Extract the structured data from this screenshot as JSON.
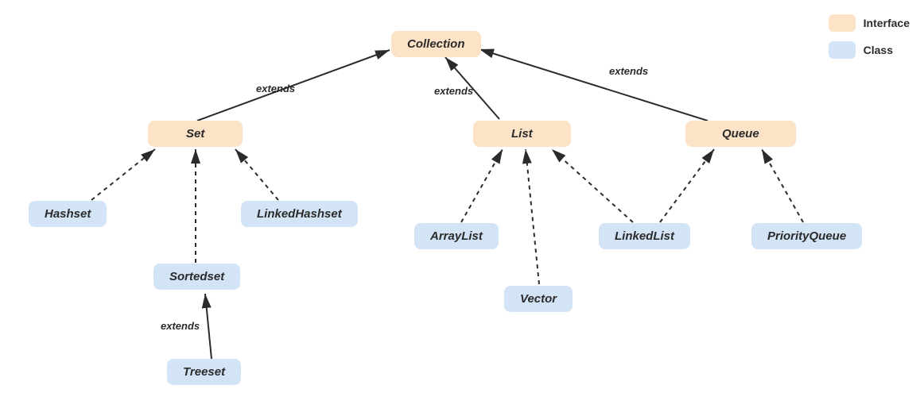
{
  "legend": {
    "interface_label": "Interface",
    "class_label": "Class"
  },
  "nodes": {
    "collection": {
      "label": "Collection",
      "kind": "interface"
    },
    "set": {
      "label": "Set",
      "kind": "interface"
    },
    "list": {
      "label": "List",
      "kind": "interface"
    },
    "queue": {
      "label": "Queue",
      "kind": "interface"
    },
    "sortedset": {
      "label": "Sortedset",
      "kind": "class"
    },
    "hashset": {
      "label": "Hashset",
      "kind": "class"
    },
    "linkedhashset": {
      "label": "LinkedHashset",
      "kind": "class"
    },
    "treeset": {
      "label": "Treeset",
      "kind": "class"
    },
    "arraylist": {
      "label": "ArrayList",
      "kind": "class"
    },
    "vector": {
      "label": "Vector",
      "kind": "class"
    },
    "linkedlist": {
      "label": "LinkedList",
      "kind": "class"
    },
    "priorityqueue": {
      "label": "PriorityQueue",
      "kind": "class"
    }
  },
  "edge_labels": {
    "set_extends": "extends",
    "list_extends": "extends",
    "queue_extends": "extends",
    "sortedset_extends": "extends"
  },
  "colors": {
    "interface_bg": "#fce3c7",
    "class_bg": "#d4e4f7",
    "edge": "#2b2b2b"
  }
}
